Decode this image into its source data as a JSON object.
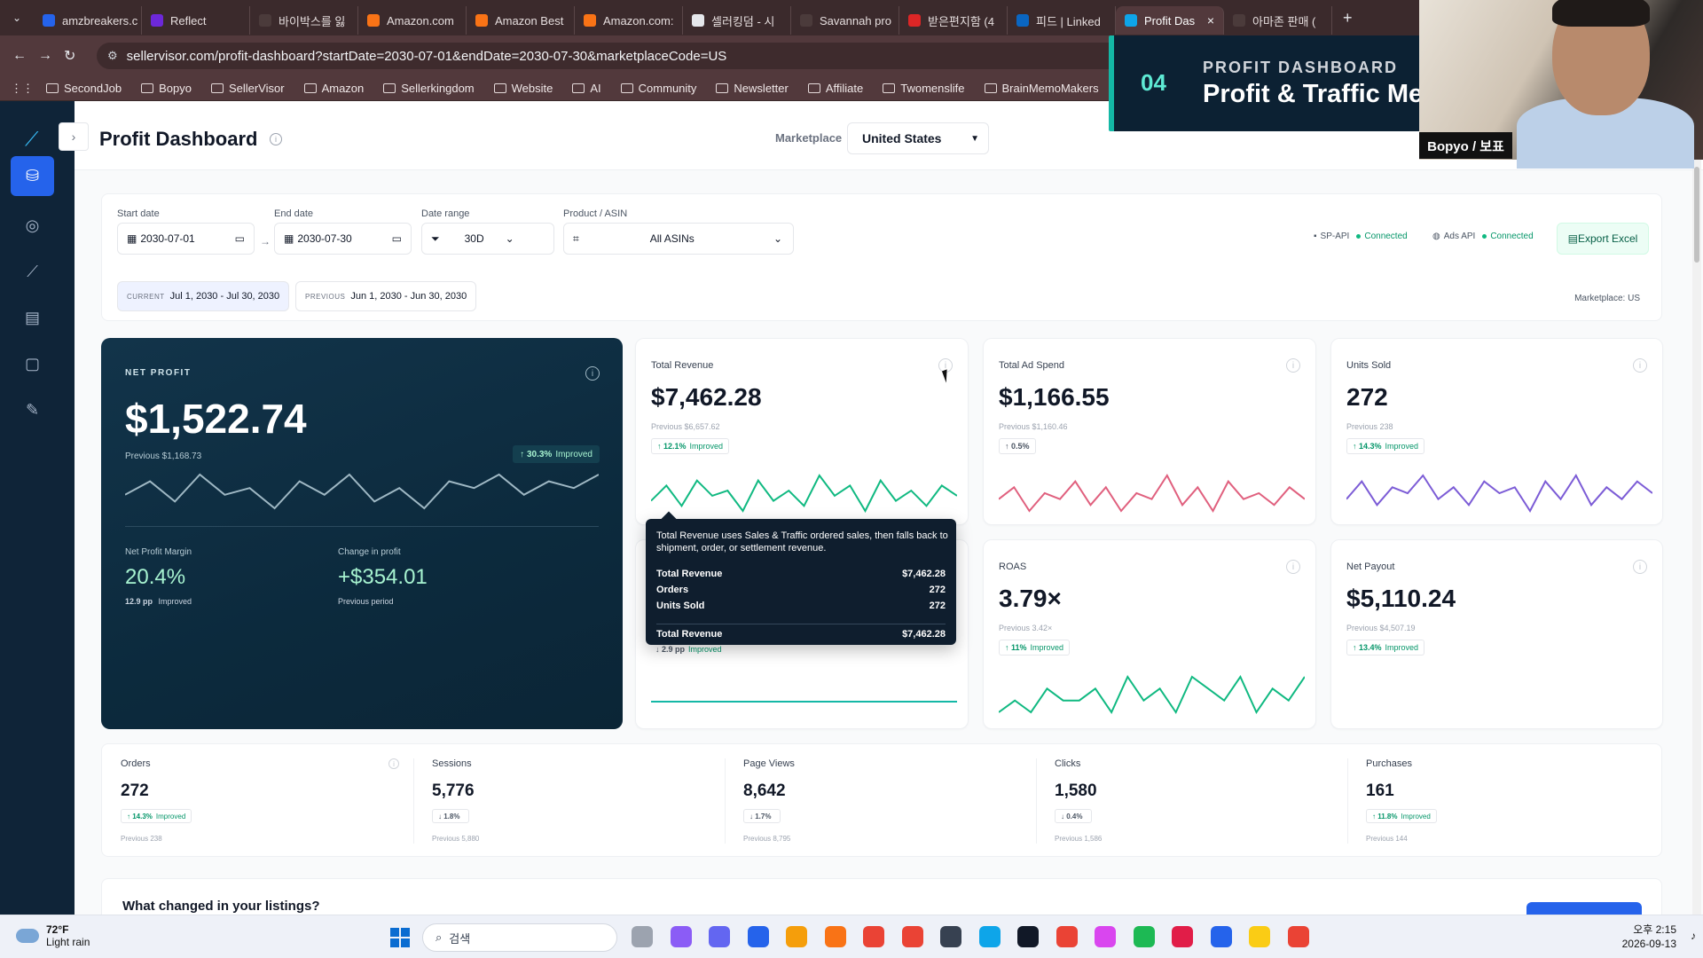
{
  "browser": {
    "tabs": [
      {
        "label": "amzbreakers.c",
        "color": "#2563eb"
      },
      {
        "label": "Reflect",
        "color": "#6d28d9"
      },
      {
        "label": "바이박스를 잃",
        "color": "#4b3b3b"
      },
      {
        "label": "Amazon.com",
        "color": "#f97316"
      },
      {
        "label": "Amazon Best",
        "color": "#f97316"
      },
      {
        "label": "Amazon.com:",
        "color": "#f97316"
      },
      {
        "label": "셀러킹덤 - 시",
        "color": "#e5e7eb"
      },
      {
        "label": "Savannah pro",
        "color": "#4b3b3b"
      },
      {
        "label": "받은편지함 (4",
        "color": "#dc2626"
      },
      {
        "label": "피드 | Linked",
        "color": "#0a66c2"
      },
      {
        "label": "Profit Das",
        "color": "#0ea5e9",
        "active": true
      },
      {
        "label": "아마존 판매 (",
        "color": "#4b3b3b"
      }
    ],
    "url": "sellervisor.com/profit-dashboard?startDate=2030-07-01&endDate=2030-07-30&marketplaceCode=US",
    "bookmarks": [
      "SecondJob",
      "Bopyo",
      "SellerVisor",
      "Amazon",
      "Sellerkingdom",
      "Website",
      "AI",
      "Community",
      "Newsletter",
      "Affiliate",
      "Twomenslife",
      "BrainMemoMakers"
    ]
  },
  "header": {
    "title": "Profit Dashboard",
    "marketplace_label": "Marketplace",
    "marketplace_value": "United States"
  },
  "filters": {
    "start_label": "Start date",
    "start_value": "2030-07-01",
    "end_label": "End date",
    "end_value": "2030-07-30",
    "range_label": "Date range",
    "range_value": "30D",
    "product_label": "Product / ASIN",
    "product_value": "All ASINs",
    "sp_api": "SP-API",
    "ads_api": "Ads API",
    "connected": "Connected",
    "export": "Export Excel",
    "current_key": "CURRENT",
    "current_value": "Jul 1, 2030 - Jul 30, 2030",
    "previous_key": "PREVIOUS",
    "previous_value": "Jun 1, 2030 - Jun 30, 2030",
    "marketplace_note": "Marketplace: US"
  },
  "net_profit": {
    "label": "NET PROFIT",
    "value": "$1,522.74",
    "previous": "Previous $1,168.73",
    "badge_pct": "30.3%",
    "badge_word": "Improved",
    "margin_label": "Net Profit Margin",
    "margin_value": "20.4%",
    "margin_pp": "12.9 pp",
    "margin_word": "Improved",
    "change_label": "Change in profit",
    "change_value": "+$354.01",
    "change_note": "Previous period"
  },
  "cards": {
    "revenue": {
      "title": "Total Revenue",
      "value": "$7,462.28",
      "prev": "Previous $6,657.62",
      "pct": "12.1%",
      "word": "Improved",
      "color": "#10b981"
    },
    "adspend": {
      "title": "Total Ad Spend",
      "value": "$1,166.55",
      "prev": "Previous $1,160.46",
      "pct": "0.5%",
      "word": "",
      "color": "#e0607e"
    },
    "units": {
      "title": "Units Sold",
      "value": "272",
      "prev": "Previous 238",
      "pct": "14.3%",
      "word": "Improved",
      "color": "#7c5cd6"
    },
    "roas": {
      "title": "ROAS",
      "value": "3.79×",
      "prev": "Previous 3.42×",
      "pct": "11%",
      "word": "Improved",
      "color": "#10b981"
    },
    "payout": {
      "title": "Net Payout",
      "value": "$5,110.24",
      "prev": "Previous $4,507.19",
      "pct": "13.4%",
      "word": "Improved",
      "color": "#14b8a6"
    },
    "hidden_badge_pp": "2.9 pp",
    "hidden_badge_word": "Improved"
  },
  "tooltip": {
    "desc": "Total Revenue uses Sales & Traffic ordered sales, then falls back to shipment, order, or settlement revenue.",
    "rows": [
      {
        "k": "Total Revenue",
        "v": "$7,462.28"
      },
      {
        "k": "Orders",
        "v": "272"
      },
      {
        "k": "Units Sold",
        "v": "272"
      }
    ],
    "total_k": "Total Revenue",
    "total_v": "$7,462.28"
  },
  "metrics": [
    {
      "title": "Orders",
      "value": "272",
      "pct": "14.3%",
      "word": "Improved",
      "dir": "↑",
      "prev": "Previous 238"
    },
    {
      "title": "Sessions",
      "value": "5,776",
      "pct": "1.8%",
      "word": "",
      "dir": "↓",
      "prev": "Previous 5,880"
    },
    {
      "title": "Page Views",
      "value": "8,642",
      "pct": "1.7%",
      "word": "",
      "dir": "↓",
      "prev": "Previous 8,795"
    },
    {
      "title": "Clicks",
      "value": "1,580",
      "pct": "0.4%",
      "word": "",
      "dir": "↓",
      "prev": "Previous 1,586"
    },
    {
      "title": "Purchases",
      "value": "161",
      "pct": "11.8%",
      "word": "Improved",
      "dir": "↑",
      "prev": "Previous 144"
    }
  ],
  "listings": {
    "title": "What changed in your listings?"
  },
  "overlay": {
    "number": "04",
    "small": "PROFIT DASHBOARD",
    "big": "Profit & Traffic Metrics"
  },
  "webcam": {
    "name": "Bopyo / 보표"
  },
  "taskbar": {
    "temp": "72°F",
    "weather": "Light rain",
    "search": "검색",
    "time": "오후 2:15",
    "date": "2026-09-13"
  },
  "sparklines": {
    "net_profit": [
      5,
      7,
      4,
      8,
      5,
      6,
      3,
      7,
      5,
      8,
      4,
      6,
      3,
      7,
      6,
      8,
      5,
      7,
      6,
      8
    ],
    "revenue": [
      4,
      7,
      3,
      8,
      5,
      6,
      2,
      8,
      4,
      6,
      3,
      9,
      5,
      7,
      2,
      8,
      4,
      6,
      3,
      7,
      5
    ],
    "adspend": [
      5,
      7,
      3,
      6,
      5,
      8,
      4,
      7,
      3,
      6,
      5,
      9,
      4,
      7,
      3,
      8,
      5,
      6,
      4,
      7,
      5
    ],
    "units": [
      5,
      8,
      4,
      7,
      6,
      9,
      5,
      7,
      4,
      8,
      6,
      7,
      3,
      8,
      5,
      9,
      4,
      7,
      5,
      8,
      6
    ],
    "roas": [
      3,
      4,
      3,
      5,
      4,
      4,
      5,
      3,
      6,
      4,
      5,
      3,
      6,
      5,
      4,
      6,
      3,
      5,
      4,
      6
    ],
    "payout": [
      4,
      4,
      4,
      4,
      4,
      4,
      4,
      4,
      4,
      4,
      4,
      4,
      4,
      4,
      4,
      4,
      4,
      4,
      4,
      4
    ]
  }
}
